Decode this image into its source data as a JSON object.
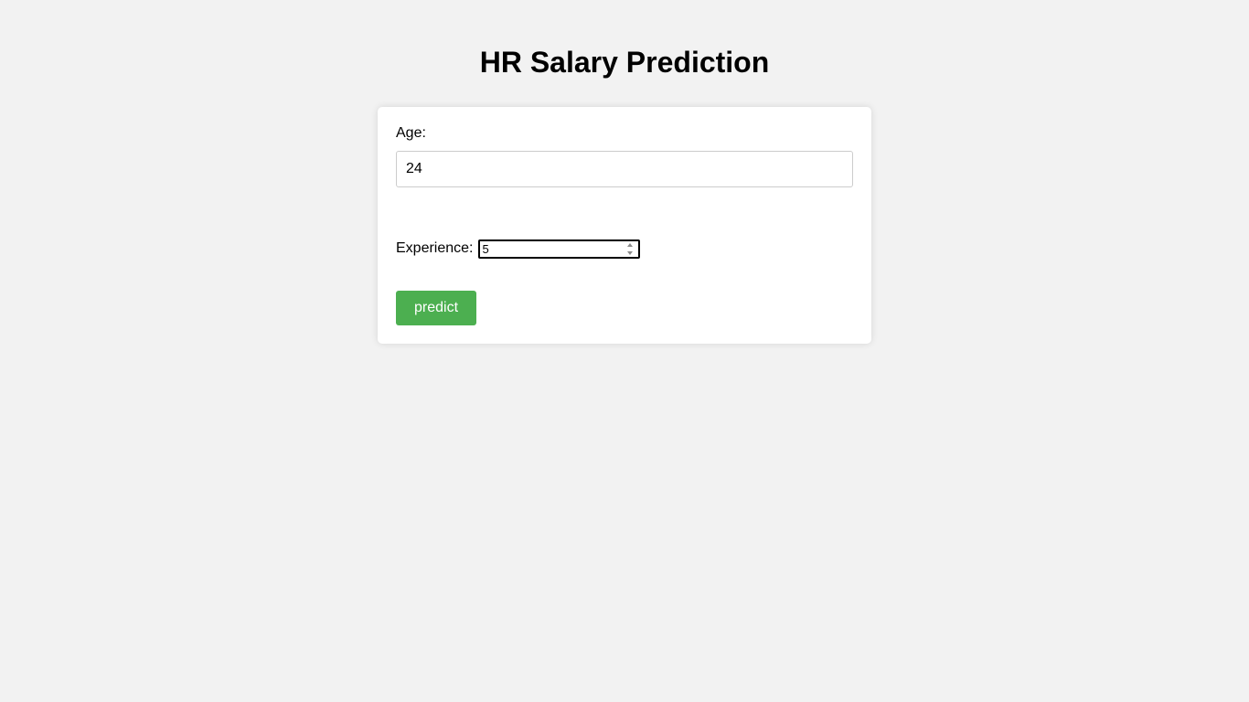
{
  "page": {
    "title": "HR Salary Prediction"
  },
  "form": {
    "age_label": "Age:",
    "age_value": "24",
    "experience_label": "Experience:",
    "experience_value": "5",
    "predict_label": "predict"
  },
  "colors": {
    "background": "#f2f2f2",
    "card": "#ffffff",
    "button": "#4caf50",
    "button_text": "#ffffff"
  }
}
